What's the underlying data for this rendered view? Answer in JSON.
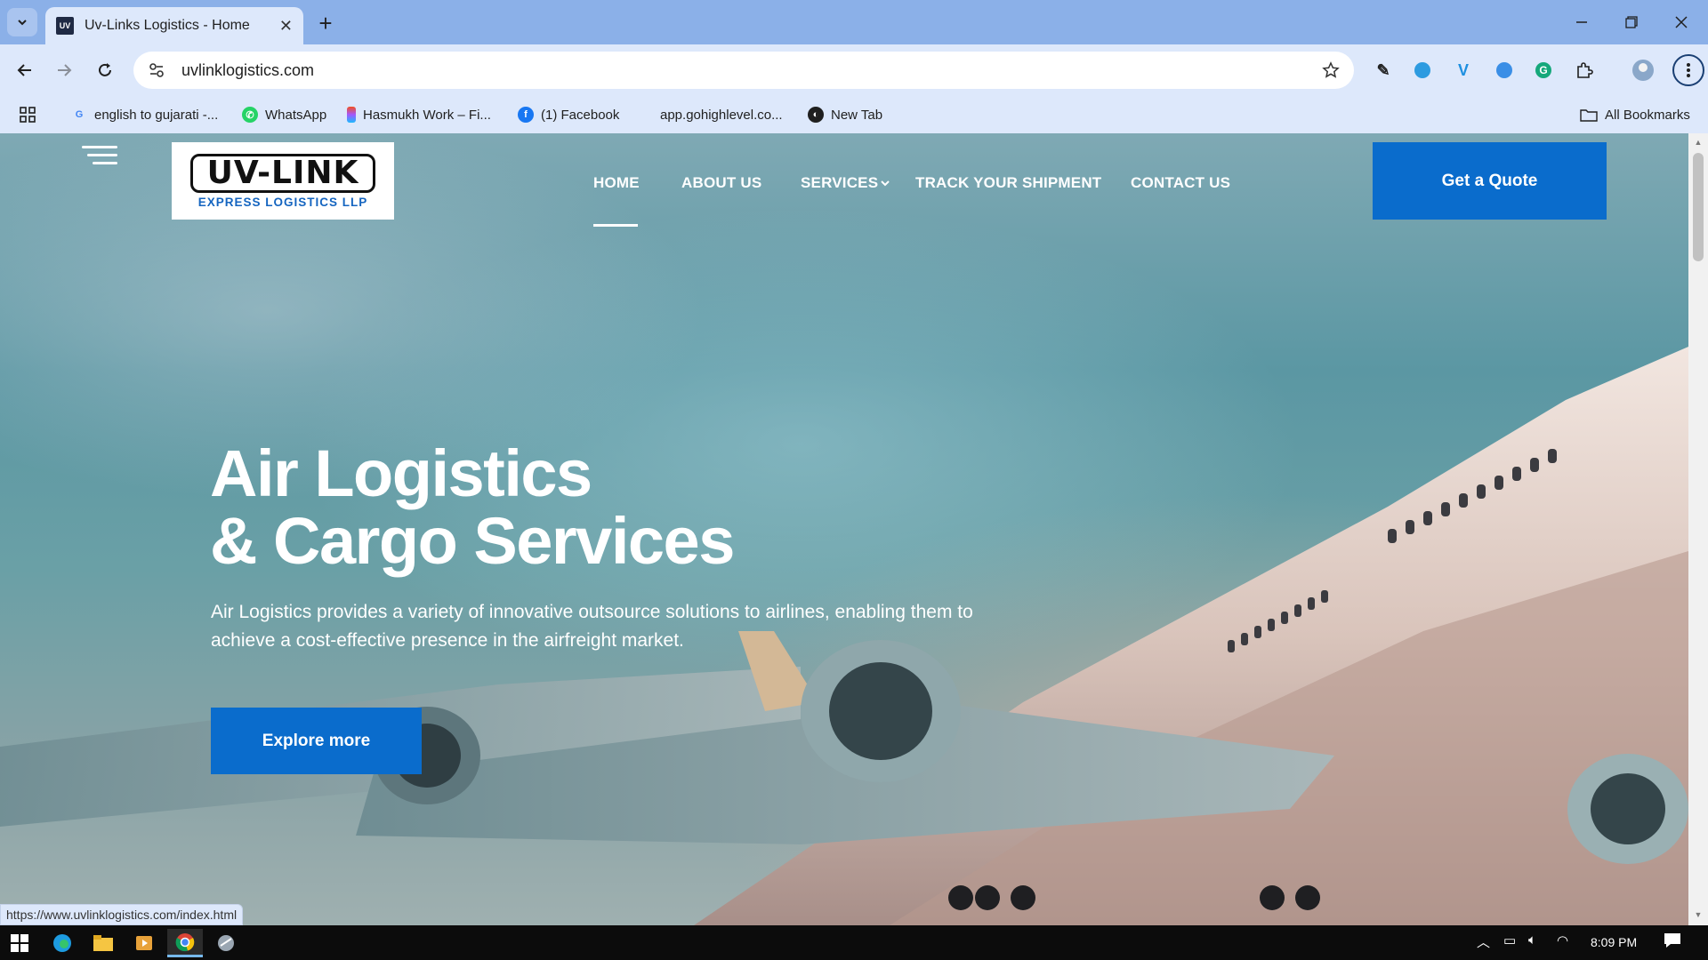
{
  "browser": {
    "tab_title": "Uv-Links Logistics - Home",
    "tab_favicon_text": "UV",
    "url": "uvlinklogistics.com",
    "bookmarks": [
      {
        "label": "english to gujarati -...",
        "icon": "google-icon",
        "color": "#4285f4"
      },
      {
        "label": "WhatsApp",
        "icon": "whatsapp-icon",
        "color": "#25d366"
      },
      {
        "label": "Hasmukh Work – Fi...",
        "icon": "figma-icon",
        "color": "#f24e1e"
      },
      {
        "label": "(1) Facebook",
        "icon": "facebook-icon",
        "color": "#1877f2"
      },
      {
        "label": "app.gohighlevel.co...",
        "icon": "blank-icon",
        "color": "#dde8fb"
      },
      {
        "label": "New Tab",
        "icon": "globe-icon",
        "color": "#1f1f1f"
      }
    ],
    "all_bookmarks": "All Bookmarks",
    "status_url": "https://www.uvlinklogistics.com/index.html"
  },
  "site": {
    "logo_main": "UV-LINK",
    "logo_sub": "EXPRESS LOGISTICS LLP",
    "nav": {
      "home": "HOME",
      "about": "ABOUT US",
      "services": "SERVICES",
      "track": "TRACK YOUR SHIPMENT",
      "contact": "CONTACT US"
    },
    "quote_button": "Get a Quote",
    "hero": {
      "title_line1": "Air Logistics",
      "title_line2": "& Cargo Services",
      "description": "Air Logistics provides a variety of innovative outsource solutions to airlines, enabling them to achieve a cost-effective presence in the airfreight market.",
      "button": "Explore more"
    },
    "colors": {
      "accent": "#0a6ccc",
      "brand_blue": "#1565c0"
    }
  },
  "taskbar": {
    "time": "8:09 PM"
  }
}
